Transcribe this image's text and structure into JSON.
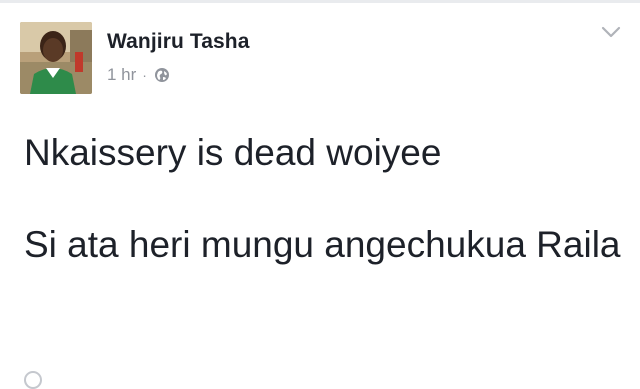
{
  "post": {
    "author": "Wanjiru Tasha",
    "time": "1 hr",
    "separator": "·",
    "privacy_icon": "globe-icon",
    "menu_icon": "chevron-down-icon",
    "text_line1": "Nkaissery is dead woiyee",
    "text_line2": "Si ata heri mungu angechukua Raila"
  },
  "colors": {
    "text": "#1d2129",
    "meta": "#90949c",
    "background": "#ffffff"
  }
}
